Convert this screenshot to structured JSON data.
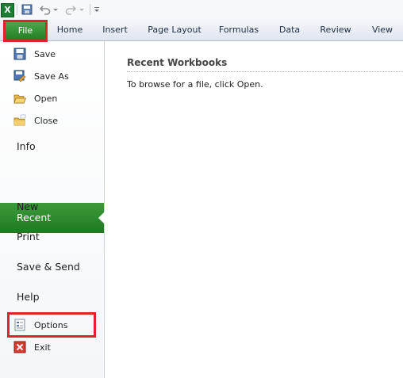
{
  "quick_access": {
    "logo_letter": "X",
    "icons": [
      "excel-logo",
      "save-icon",
      "undo-icon",
      "redo-icon",
      "customize-qat-icon"
    ]
  },
  "ribbon": {
    "tabs": [
      "File",
      "Home",
      "Insert",
      "Page Layout",
      "Formulas",
      "Data",
      "Review",
      "View"
    ],
    "active_tab": "File"
  },
  "backstage": {
    "commands": [
      {
        "label": "Save",
        "icon": "save-icon"
      },
      {
        "label": "Save As",
        "icon": "save-as-icon"
      },
      {
        "label": "Open",
        "icon": "open-folder-icon"
      },
      {
        "label": "Close",
        "icon": "close-folder-icon"
      }
    ],
    "sections": [
      "Info",
      "Recent",
      "New",
      "Print",
      "Save & Send",
      "Help"
    ],
    "selected_section": "Recent",
    "bottom_commands": [
      {
        "label": "Options",
        "icon": "options-icon"
      },
      {
        "label": "Exit",
        "icon": "exit-icon"
      }
    ]
  },
  "content": {
    "title": "Recent Workbooks",
    "hint": "To browse for a file, click Open."
  },
  "colors": {
    "accent_green": "#237d23",
    "highlight_red": "#e0232b"
  }
}
